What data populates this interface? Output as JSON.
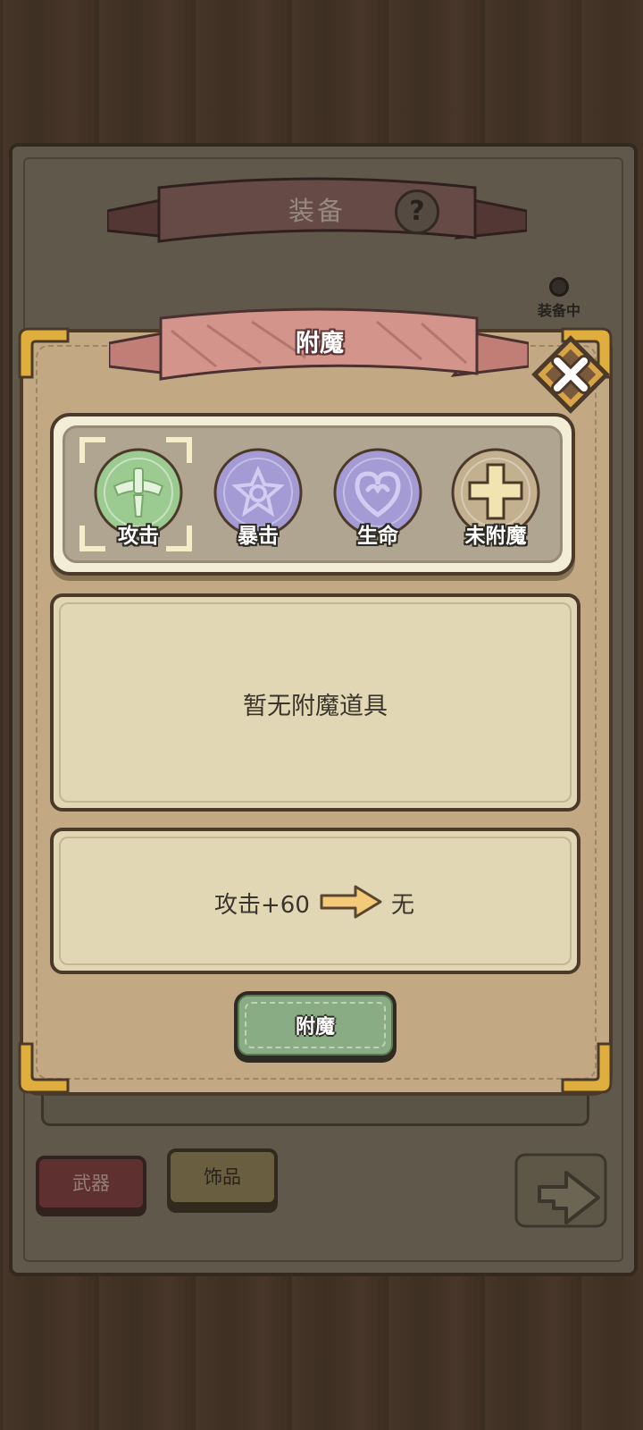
{
  "background_screen": {
    "title": "装备",
    "help_icon": "question-mark-icon",
    "equipped_tag": "装备中",
    "tabs": [
      {
        "label": "武器"
      },
      {
        "label": "饰品"
      }
    ],
    "back_icon": "return-arrow-icon"
  },
  "dialog": {
    "title": "附魔",
    "close_icon": "close-x-icon",
    "options": [
      {
        "label": "攻击",
        "icon": "sword-icon",
        "color": "#9ccb91",
        "selected": true
      },
      {
        "label": "暴击",
        "icon": "star-burst-icon",
        "color": "#a49bd4",
        "selected": false
      },
      {
        "label": "生命",
        "icon": "heart-swirl-icon",
        "color": "#a49bd4",
        "selected": false
      },
      {
        "label": "未附魔",
        "icon": "plus-icon",
        "color": "#c3b08f",
        "selected": false
      }
    ],
    "empty_message": "暂无附魔道具",
    "compare": {
      "before": "攻击+60",
      "arrow_icon": "right-arrow-icon",
      "after": "无"
    },
    "enchant_button": "附魔"
  },
  "colors": {
    "wood": "#4e3c2d",
    "parchment": "#c2a984",
    "ribbon": "#cf8d84",
    "button_green": "#8aac85",
    "gold_corner": "#e0ae3c"
  }
}
